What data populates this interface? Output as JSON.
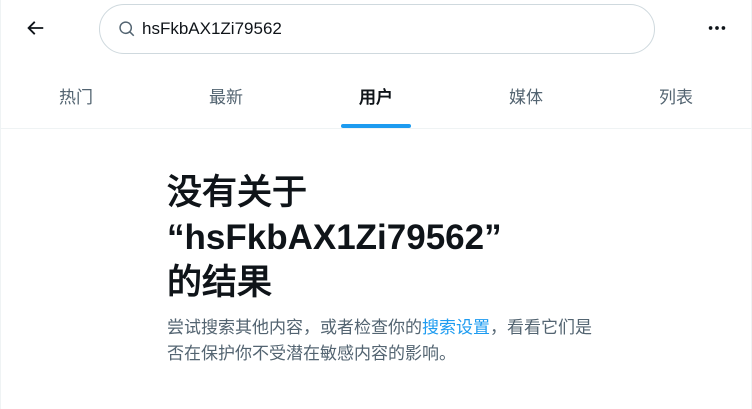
{
  "header": {
    "back_icon": "arrow-left-icon",
    "search": {
      "icon": "search-icon",
      "value": "hsFkbAX1Zi79562",
      "placeholder": ""
    },
    "more_icon": "more-horizontal-icon"
  },
  "tabs": [
    {
      "label": "热门",
      "active": false
    },
    {
      "label": "最新",
      "active": false
    },
    {
      "label": "用户",
      "active": true
    },
    {
      "label": "媒体",
      "active": false
    },
    {
      "label": "列表",
      "active": false
    }
  ],
  "empty_state": {
    "title_line1": "没有关于",
    "title_line2": "“hsFkbAX1Zi79562”",
    "title_line3": "的结果",
    "desc_before": "尝试搜索其他内容，或者检查你的",
    "desc_link": "搜索设置",
    "desc_after": "，看看它们是否在保护你不受潜在敏感内容的影响。"
  },
  "colors": {
    "accent": "#1d9bf0",
    "text_primary": "#0f1419",
    "text_secondary": "#536471",
    "border": "#cfd9de"
  }
}
